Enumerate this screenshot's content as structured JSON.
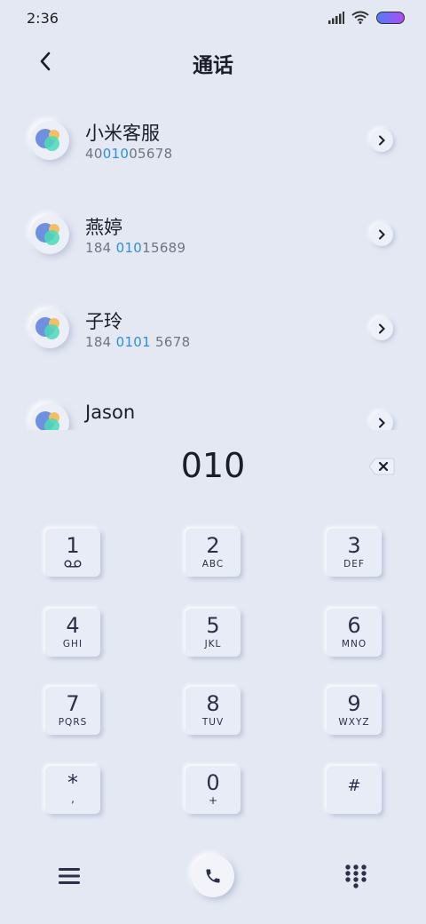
{
  "status_bar": {
    "time": "2:36"
  },
  "header": {
    "title": "通话"
  },
  "contacts": [
    {
      "name": "小米客服",
      "number_pre": "40",
      "number_match": "010",
      "number_post": "05678"
    },
    {
      "name": "燕婷",
      "number_pre": "184 ",
      "number_match": "010",
      "number_post": "15689"
    },
    {
      "name": "子玲",
      "number_pre": "184 ",
      "number_match": "0101",
      "number_post": " 5678"
    },
    {
      "name": "Jason",
      "number_pre": "",
      "number_match": "",
      "number_post": ""
    }
  ],
  "dialer": {
    "input": "010"
  },
  "keypad": [
    {
      "digit": "1",
      "letters": ""
    },
    {
      "digit": "2",
      "letters": "ABC"
    },
    {
      "digit": "3",
      "letters": "DEF"
    },
    {
      "digit": "4",
      "letters": "GHI"
    },
    {
      "digit": "5",
      "letters": "JKL"
    },
    {
      "digit": "6",
      "letters": "MNO"
    },
    {
      "digit": "7",
      "letters": "PQRS"
    },
    {
      "digit": "8",
      "letters": "TUV"
    },
    {
      "digit": "9",
      "letters": "WXYZ"
    },
    {
      "digit": "*",
      "letters": ","
    },
    {
      "digit": "0",
      "letters": "+"
    },
    {
      "digit": "#",
      "letters": ""
    }
  ],
  "icons": {
    "status": [
      "signal-icon",
      "wifi-icon",
      "battery-icon"
    ],
    "header": "back-arrow-icon",
    "row": "chevron-right-icon",
    "delete": "backspace-icon",
    "voicemail": "voicemail-icon",
    "bottom": [
      "menu-icon",
      "phone-icon",
      "dialpad-icon"
    ]
  },
  "colors": {
    "background": "#e3e8f3",
    "highlight": "#2f8fd8",
    "battery_start": "#4f7cf7",
    "battery_end": "#b04cf0"
  }
}
